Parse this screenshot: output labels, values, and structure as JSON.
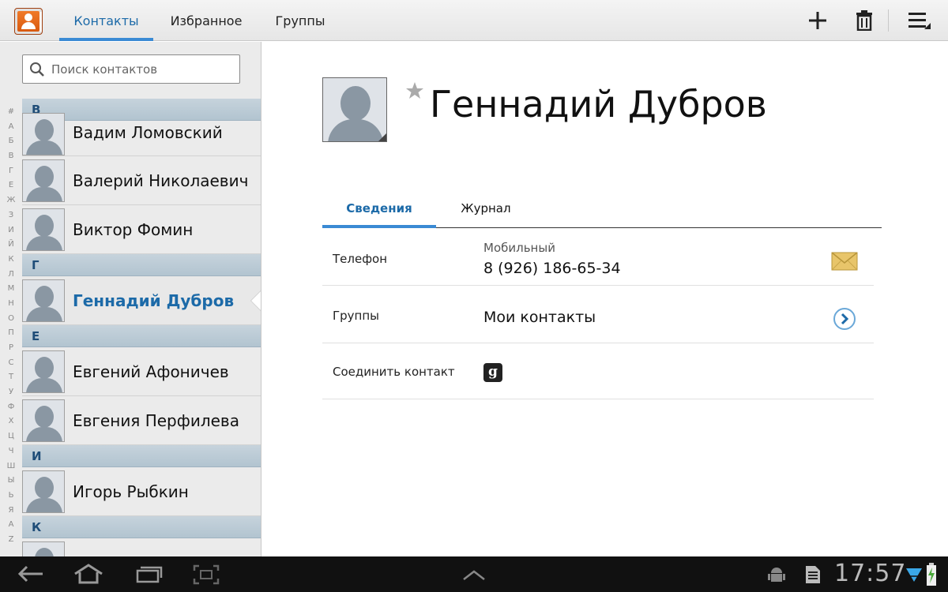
{
  "topbar": {
    "tabs": [
      {
        "label": "Контакты",
        "active": true
      },
      {
        "label": "Избранное",
        "active": false
      },
      {
        "label": "Группы",
        "active": false
      }
    ],
    "icons": [
      "contacts-app-icon",
      "add-icon",
      "delete-icon",
      "menu-icon"
    ]
  },
  "search": {
    "placeholder": "Поиск контактов"
  },
  "alphabet": [
    "#",
    "А",
    "Б",
    "В",
    "Г",
    "Е",
    "Ж",
    "З",
    "И",
    "Й",
    "К",
    "Л",
    "М",
    "Н",
    "О",
    "П",
    "Р",
    "С",
    "Т",
    "У",
    "Ф",
    "Х",
    "Ц",
    "Ч",
    "Ш",
    "Ы",
    "Ь",
    "Я",
    "А",
    "Z"
  ],
  "contacts": {
    "header_v": "В",
    "vadim": "Вадим Ломовский",
    "valery": "Валерий Николаевич",
    "viktor": "Виктор Фомин",
    "header_g": "Г",
    "gennady": "Геннадий Дубров",
    "header_e": "Е",
    "evgeny": "Евгений Афоничев",
    "evgenia": "Евгения Перфилева",
    "header_i": "И",
    "igor": "Игорь Рыбкин",
    "header_k": "К",
    "k_partial": "К"
  },
  "detail": {
    "name": "Геннадий Дубров",
    "tabs": {
      "info": "Сведения",
      "log": "Журнал"
    },
    "phone": {
      "label": "Телефон",
      "type": "Мобильный",
      "number": "8 (926) 186-65-34"
    },
    "groups": {
      "label": "Группы",
      "value": "Мои контакты"
    },
    "join": {
      "label": "Соединить контакт",
      "icon_letter": "g"
    }
  },
  "sysbar": {
    "time": "17:57"
  },
  "colors": {
    "accent": "#1c6aa8",
    "tab_indicator": "#3a8ad4",
    "section_header": "#b9c9d4"
  }
}
